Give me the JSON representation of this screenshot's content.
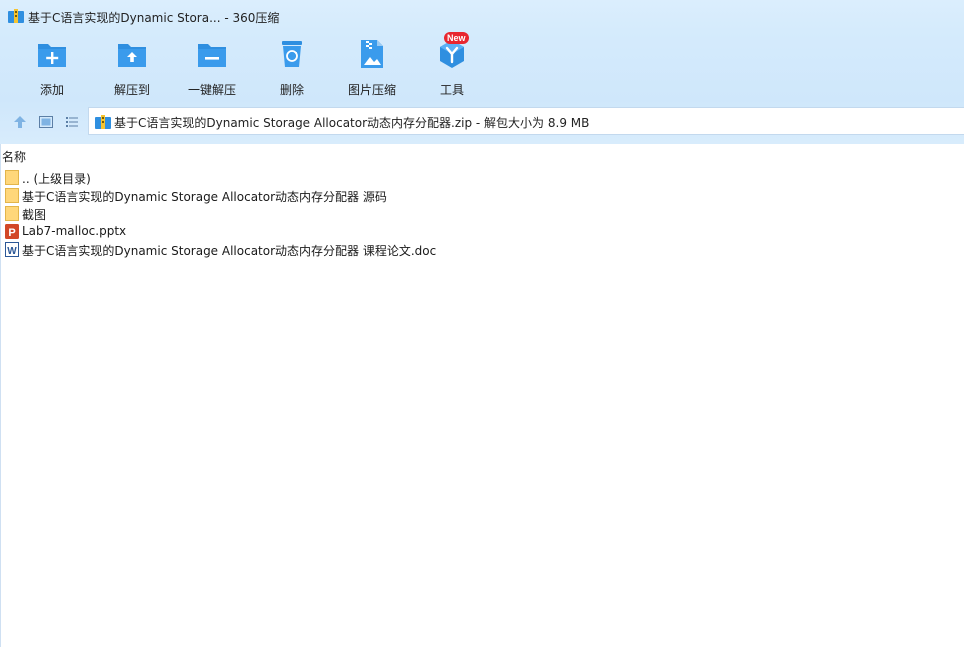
{
  "window": {
    "title": "基于C语言实现的Dynamic Stora... - 360压缩"
  },
  "toolbar": {
    "items": [
      {
        "label": "添加",
        "icon": "add-icon"
      },
      {
        "label": "解压到",
        "icon": "extract-to-icon"
      },
      {
        "label": "一键解压",
        "icon": "one-click-extract-icon"
      },
      {
        "label": "删除",
        "icon": "delete-icon"
      },
      {
        "label": "图片压缩",
        "icon": "image-compress-icon"
      },
      {
        "label": "工具",
        "icon": "tools-icon",
        "badge": "New"
      }
    ]
  },
  "path": {
    "text": "基于C语言实现的Dynamic Storage Allocator动态内存分配器.zip - 解包大小为 8.9 MB"
  },
  "file_list": {
    "column_name": "名称",
    "rows": [
      {
        "name": ".. (上级目录)",
        "type": "folder"
      },
      {
        "name": "基于C语言实现的Dynamic Storage Allocator动态内存分配器 源码",
        "type": "folder"
      },
      {
        "name": "截图",
        "type": "folder"
      },
      {
        "name": "Lab7-malloc.pptx",
        "type": "pptx"
      },
      {
        "name": "基于C语言实现的Dynamic Storage Allocator动态内存分配器 课程论文.doc",
        "type": "doc"
      }
    ]
  },
  "colors": {
    "accent": "#2f8fe0",
    "folder": "#ffd77a",
    "ppt": "#d24726",
    "word": "#2b5797",
    "badge": "#e8262f"
  }
}
